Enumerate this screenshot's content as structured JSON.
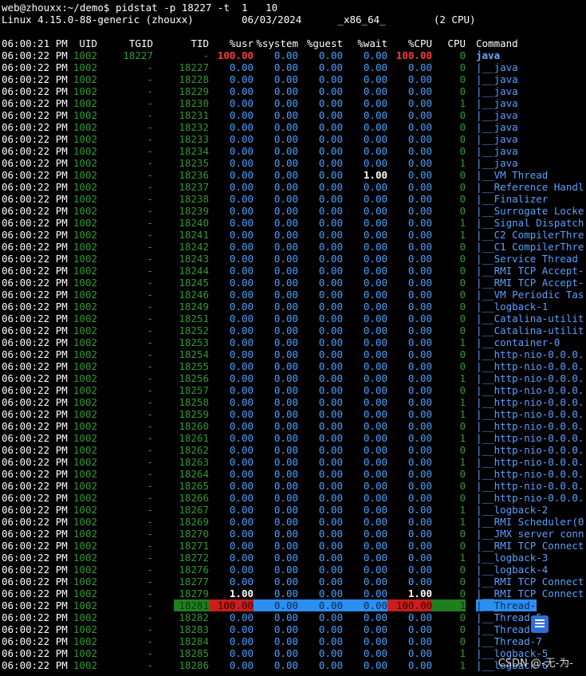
{
  "terminal": {
    "prompt_line": "web@zhouxx:~/demo$ pidstat -p 18227 -t  1   10",
    "sys_line": "Linux 4.15.0-88-generic (zhouxx)        06/03/2024      _x86_64_        (2 CPU)",
    "header": [
      "06:00:21 PM",
      "UID",
      "TGID",
      "TID",
      "%usr",
      "%system",
      "%guest",
      "%wait",
      "%CPU",
      "CPU",
      "Command"
    ],
    "rows": [
      [
        "06:00:22 PM",
        "1002",
        "18227",
        "-",
        "100.00",
        "0.00",
        "0.00",
        "0.00",
        "100.00",
        "0",
        "java"
      ],
      [
        "06:00:22 PM",
        "1002",
        "-",
        "18227",
        "0.00",
        "0.00",
        "0.00",
        "0.00",
        "0.00",
        "0",
        "|__java"
      ],
      [
        "06:00:22 PM",
        "1002",
        "-",
        "18228",
        "0.00",
        "0.00",
        "0.00",
        "0.00",
        "0.00",
        "0",
        "|__java"
      ],
      [
        "06:00:22 PM",
        "1002",
        "-",
        "18229",
        "0.00",
        "0.00",
        "0.00",
        "0.00",
        "0.00",
        "0",
        "|__java"
      ],
      [
        "06:00:22 PM",
        "1002",
        "-",
        "18230",
        "0.00",
        "0.00",
        "0.00",
        "0.00",
        "0.00",
        "1",
        "|__java"
      ],
      [
        "06:00:22 PM",
        "1002",
        "-",
        "18231",
        "0.00",
        "0.00",
        "0.00",
        "0.00",
        "0.00",
        "0",
        "|__java"
      ],
      [
        "06:00:22 PM",
        "1002",
        "-",
        "18232",
        "0.00",
        "0.00",
        "0.00",
        "0.00",
        "0.00",
        "0",
        "|__java"
      ],
      [
        "06:00:22 PM",
        "1002",
        "-",
        "18233",
        "0.00",
        "0.00",
        "0.00",
        "0.00",
        "0.00",
        "0",
        "|__java"
      ],
      [
        "06:00:22 PM",
        "1002",
        "-",
        "18234",
        "0.00",
        "0.00",
        "0.00",
        "0.00",
        "0.00",
        "0",
        "|__java"
      ],
      [
        "06:00:22 PM",
        "1002",
        "-",
        "18235",
        "0.00",
        "0.00",
        "0.00",
        "0.00",
        "0.00",
        "1",
        "|__java"
      ],
      [
        "06:00:22 PM",
        "1002",
        "-",
        "18236",
        "0.00",
        "0.00",
        "0.00",
        "1.00",
        "0.00",
        "0",
        "|__VM Thread"
      ],
      [
        "06:00:22 PM",
        "1002",
        "-",
        "18237",
        "0.00",
        "0.00",
        "0.00",
        "0.00",
        "0.00",
        "0",
        "|__Reference Handl"
      ],
      [
        "06:00:22 PM",
        "1002",
        "-",
        "18238",
        "0.00",
        "0.00",
        "0.00",
        "0.00",
        "0.00",
        "0",
        "|__Finalizer"
      ],
      [
        "06:00:22 PM",
        "1002",
        "-",
        "18239",
        "0.00",
        "0.00",
        "0.00",
        "0.00",
        "0.00",
        "0",
        "|__Surrogate Locke"
      ],
      [
        "06:00:22 PM",
        "1002",
        "-",
        "18240",
        "0.00",
        "0.00",
        "0.00",
        "0.00",
        "0.00",
        "1",
        "|__Signal Dispatch"
      ],
      [
        "06:00:22 PM",
        "1002",
        "-",
        "18241",
        "0.00",
        "0.00",
        "0.00",
        "0.00",
        "0.00",
        "1",
        "|__C2 CompilerThre"
      ],
      [
        "06:00:22 PM",
        "1002",
        "-",
        "18242",
        "0.00",
        "0.00",
        "0.00",
        "0.00",
        "0.00",
        "0",
        "|__C1 CompilerThre"
      ],
      [
        "06:00:22 PM",
        "1002",
        "-",
        "18243",
        "0.00",
        "0.00",
        "0.00",
        "0.00",
        "0.00",
        "0",
        "|__Service Thread"
      ],
      [
        "06:00:22 PM",
        "1002",
        "-",
        "18244",
        "0.00",
        "0.00",
        "0.00",
        "0.00",
        "0.00",
        "0",
        "|__RMI TCP Accept-"
      ],
      [
        "06:00:22 PM",
        "1002",
        "-",
        "18245",
        "0.00",
        "0.00",
        "0.00",
        "0.00",
        "0.00",
        "0",
        "|__RMI TCP Accept-"
      ],
      [
        "06:00:22 PM",
        "1002",
        "-",
        "18246",
        "0.00",
        "0.00",
        "0.00",
        "0.00",
        "0.00",
        "0",
        "|__VM Periodic Tas"
      ],
      [
        "06:00:22 PM",
        "1002",
        "-",
        "18249",
        "0.00",
        "0.00",
        "0.00",
        "0.00",
        "0.00",
        "0",
        "|__logback-1"
      ],
      [
        "06:00:22 PM",
        "1002",
        "-",
        "18251",
        "0.00",
        "0.00",
        "0.00",
        "0.00",
        "0.00",
        "0",
        "|__Catalina-utilit"
      ],
      [
        "06:00:22 PM",
        "1002",
        "-",
        "18252",
        "0.00",
        "0.00",
        "0.00",
        "0.00",
        "0.00",
        "0",
        "|__Catalina-utilit"
      ],
      [
        "06:00:22 PM",
        "1002",
        "-",
        "18253",
        "0.00",
        "0.00",
        "0.00",
        "0.00",
        "0.00",
        "1",
        "|__container-0"
      ],
      [
        "06:00:22 PM",
        "1002",
        "-",
        "18254",
        "0.00",
        "0.00",
        "0.00",
        "0.00",
        "0.00",
        "0",
        "|__http-nio-0.0.0."
      ],
      [
        "06:00:22 PM",
        "1002",
        "-",
        "18255",
        "0.00",
        "0.00",
        "0.00",
        "0.00",
        "0.00",
        "0",
        "|__http-nio-0.0.0."
      ],
      [
        "06:00:22 PM",
        "1002",
        "-",
        "18256",
        "0.00",
        "0.00",
        "0.00",
        "0.00",
        "0.00",
        "1",
        "|__http-nio-0.0.0."
      ],
      [
        "06:00:22 PM",
        "1002",
        "-",
        "18257",
        "0.00",
        "0.00",
        "0.00",
        "0.00",
        "0.00",
        "0",
        "|__http-nio-0.0.0."
      ],
      [
        "06:00:22 PM",
        "1002",
        "-",
        "18258",
        "0.00",
        "0.00",
        "0.00",
        "0.00",
        "0.00",
        "1",
        "|__http-nio-0.0.0."
      ],
      [
        "06:00:22 PM",
        "1002",
        "-",
        "18259",
        "0.00",
        "0.00",
        "0.00",
        "0.00",
        "0.00",
        "1",
        "|__http-nio-0.0.0."
      ],
      [
        "06:00:22 PM",
        "1002",
        "-",
        "18260",
        "0.00",
        "0.00",
        "0.00",
        "0.00",
        "0.00",
        "0",
        "|__http-nio-0.0.0."
      ],
      [
        "06:00:22 PM",
        "1002",
        "-",
        "18261",
        "0.00",
        "0.00",
        "0.00",
        "0.00",
        "0.00",
        "1",
        "|__http-nio-0.0.0."
      ],
      [
        "06:00:22 PM",
        "1002",
        "-",
        "18262",
        "0.00",
        "0.00",
        "0.00",
        "0.00",
        "0.00",
        "0",
        "|__http-nio-0.0.0."
      ],
      [
        "06:00:22 PM",
        "1002",
        "-",
        "18263",
        "0.00",
        "0.00",
        "0.00",
        "0.00",
        "0.00",
        "1",
        "|__http-nio-0.0.0."
      ],
      [
        "06:00:22 PM",
        "1002",
        "-",
        "18264",
        "0.00",
        "0.00",
        "0.00",
        "0.00",
        "0.00",
        "0",
        "|__http-nio-0.0.0."
      ],
      [
        "06:00:22 PM",
        "1002",
        "-",
        "18265",
        "0.00",
        "0.00",
        "0.00",
        "0.00",
        "0.00",
        "0",
        "|__http-nio-0.0.0."
      ],
      [
        "06:00:22 PM",
        "1002",
        "-",
        "18266",
        "0.00",
        "0.00",
        "0.00",
        "0.00",
        "0.00",
        "0",
        "|__http-nio-0.0.0."
      ],
      [
        "06:00:22 PM",
        "1002",
        "-",
        "18267",
        "0.00",
        "0.00",
        "0.00",
        "0.00",
        "0.00",
        "1",
        "|__logback-2"
      ],
      [
        "06:00:22 PM",
        "1002",
        "-",
        "18269",
        "0.00",
        "0.00",
        "0.00",
        "0.00",
        "0.00",
        "1",
        "|__RMI Scheduler(0"
      ],
      [
        "06:00:22 PM",
        "1002",
        "-",
        "18270",
        "0.00",
        "0.00",
        "0.00",
        "0.00",
        "0.00",
        "0",
        "|__JMX server conn"
      ],
      [
        "06:00:22 PM",
        "1002",
        "-",
        "18271",
        "0.00",
        "0.00",
        "0.00",
        "0.00",
        "0.00",
        "0",
        "|__RMI TCP Connect"
      ],
      [
        "06:00:22 PM",
        "1002",
        "-",
        "18272",
        "0.00",
        "0.00",
        "0.00",
        "0.00",
        "0.00",
        "1",
        "|__logback-3"
      ],
      [
        "06:00:22 PM",
        "1002",
        "-",
        "18276",
        "0.00",
        "0.00",
        "0.00",
        "0.00",
        "0.00",
        "0",
        "|__logback-4"
      ],
      [
        "06:00:22 PM",
        "1002",
        "-",
        "18277",
        "0.00",
        "0.00",
        "0.00",
        "0.00",
        "0.00",
        "0",
        "|__RMI TCP Connect"
      ],
      [
        "06:00:22 PM",
        "1002",
        "-",
        "18279",
        "1.00",
        "0.00",
        "0.00",
        "0.00",
        "1.00",
        "0",
        "|__RMI TCP Connect"
      ],
      [
        "06:00:22 PM",
        "1002",
        "-",
        "18281",
        "100.00",
        "0.00",
        "0.00",
        "0.00",
        "100.00",
        "1",
        "|__Thread-4"
      ],
      [
        "06:00:22 PM",
        "1002",
        "-",
        "18282",
        "0.00",
        "0.00",
        "0.00",
        "0.00",
        "0.00",
        "0",
        "|__Thread-5"
      ],
      [
        "06:00:22 PM",
        "1002",
        "-",
        "18283",
        "0.00",
        "0.00",
        "0.00",
        "0.00",
        "0.00",
        "0",
        "|__Thread-6"
      ],
      [
        "06:00:22 PM",
        "1002",
        "-",
        "18284",
        "0.00",
        "0.00",
        "0.00",
        "0.00",
        "0.00",
        "0",
        "|__Thread-7"
      ],
      [
        "06:00:22 PM",
        "1002",
        "-",
        "18285",
        "0.00",
        "0.00",
        "0.00",
        "0.00",
        "0.00",
        "1",
        "|__logback-5"
      ],
      [
        "06:00:22 PM",
        "1002",
        "-",
        "18286",
        "0.00",
        "0.00",
        "0.00",
        "0.00",
        "0.00",
        "1",
        "|__logback-6"
      ]
    ]
  },
  "watermark": "CSDN @-无-为-",
  "watermark_icon": "document-list-icon",
  "colors": {
    "background": "#000000",
    "uid_tid_green": "#2f9a2f",
    "value_blue": "#4aa0ff",
    "high_red": "#ff3a3a",
    "highlight_blue": "#2b8ff0",
    "highlight_red": "#c81e1e",
    "highlight_green": "#1f7f1f"
  }
}
